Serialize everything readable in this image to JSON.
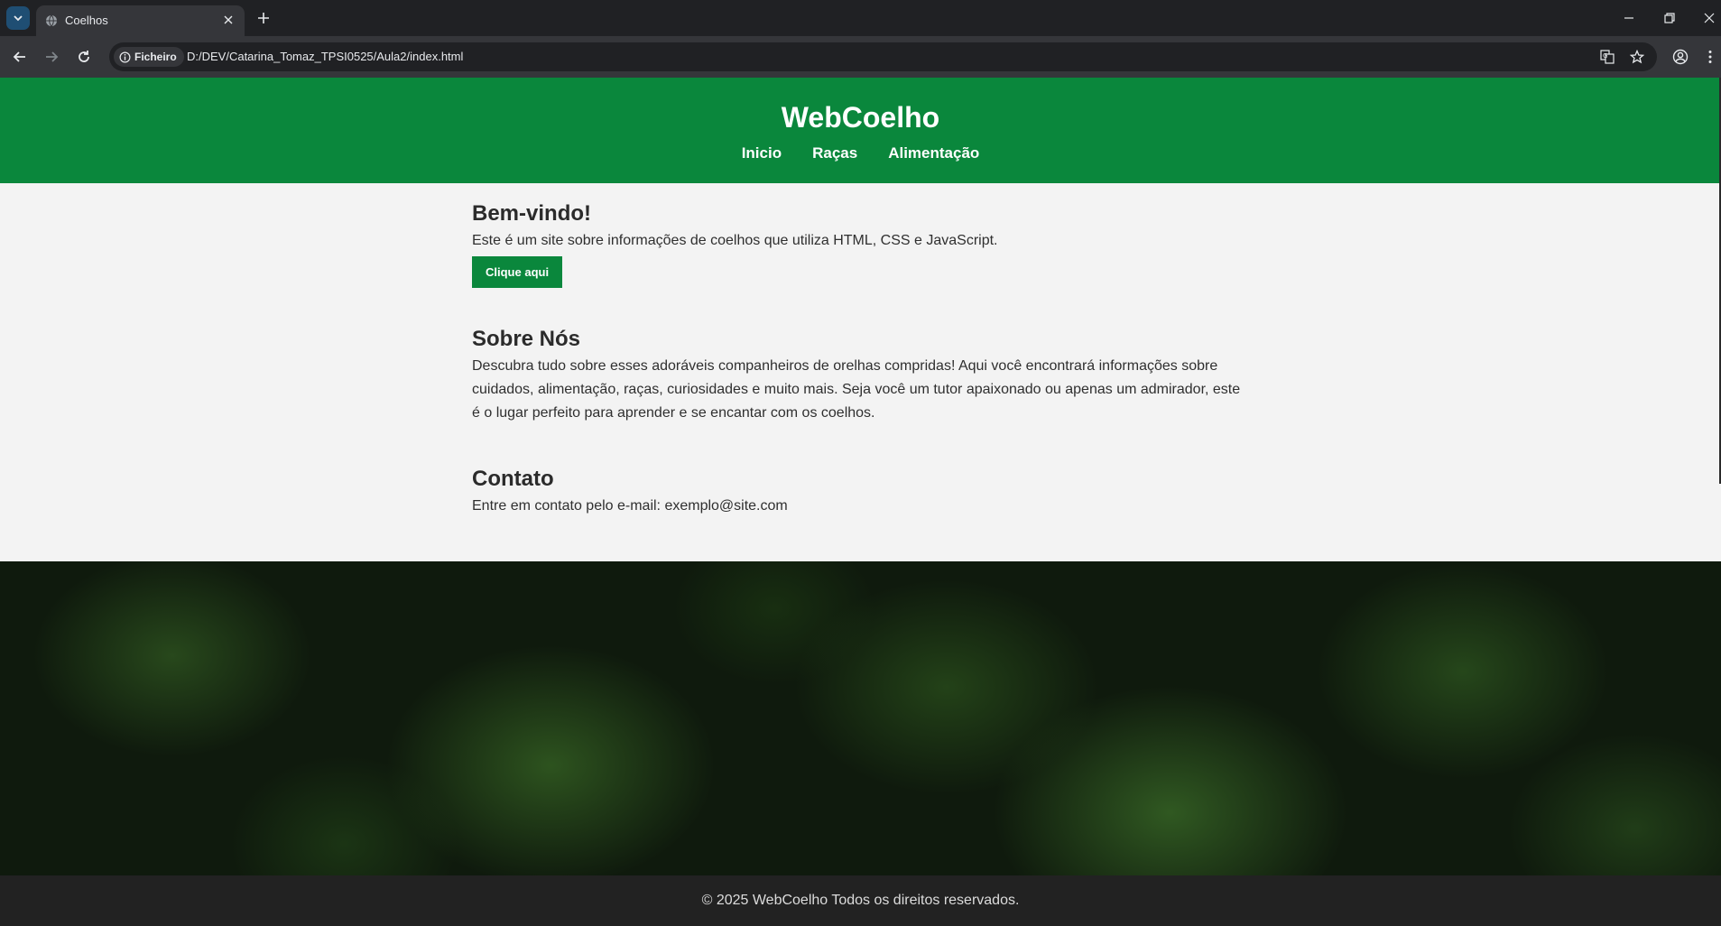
{
  "browser": {
    "tab": {
      "title": "Coelhos"
    },
    "address_bar": {
      "chip_label": "Ficheiro",
      "url": "D:/DEV/Catarina_Tomaz_TPSI0525/Aula2/index.html"
    }
  },
  "site": {
    "title": "WebCoelho",
    "nav": [
      "Inicio",
      "Raças",
      "Alimentação"
    ],
    "welcome": {
      "heading": "Bem-vindo!",
      "text": "Este é um site sobre informações de coelhos que utiliza HTML, CSS e JavaScript.",
      "button_label": "Clique aqui"
    },
    "about": {
      "heading": "Sobre Nós",
      "text": "Descubra tudo sobre esses adoráveis companheiros de orelhas compridas! Aqui você encontrará informações sobre cuidados, alimentação, raças, curiosidades e muito mais. Seja você um tutor apaixonado ou apenas um admirador, este é o lugar perfeito para aprender e se encantar com os coelhos."
    },
    "contact": {
      "heading": "Contato",
      "text": "Entre em contato pelo e-mail: exemplo@site.com"
    },
    "footer": "© 2025 WebCoelho Todos os direitos reservados."
  },
  "colors": {
    "brand_green": "#0a873c",
    "content_bg": "#f3f3f3",
    "footer_bg": "#222222",
    "chrome_dark": "#202124",
    "chrome_toolbar": "#35363a"
  }
}
